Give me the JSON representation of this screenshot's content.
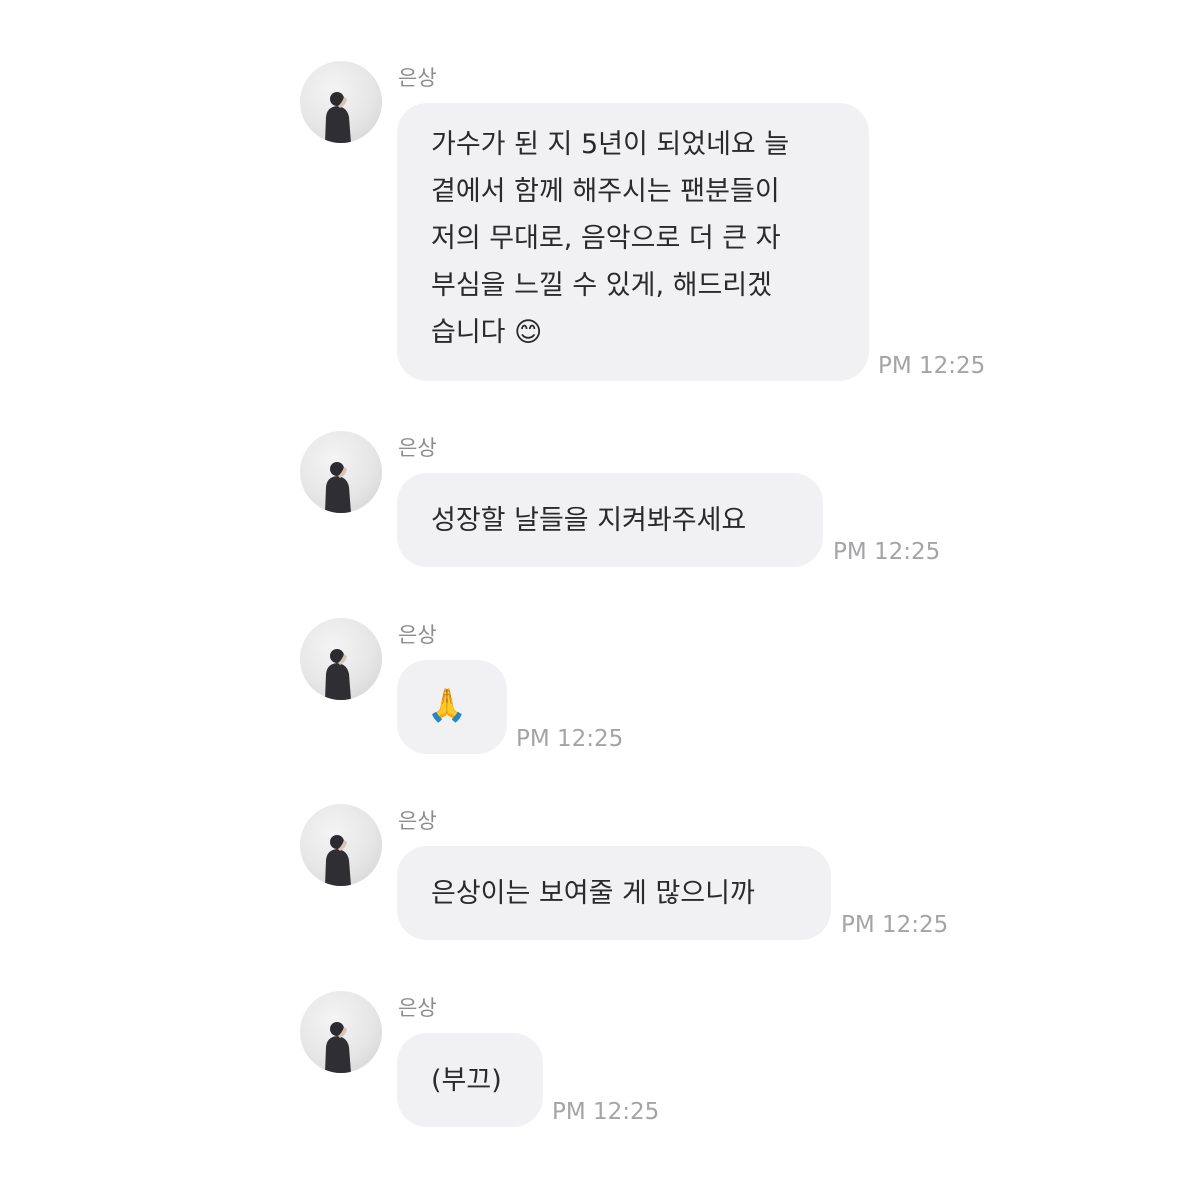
{
  "messages": [
    {
      "sender": "은상",
      "lines": [
        "가수가 된 지 5년이 되었네요 늘",
        "곁에서 함께 해주시는 팬분들이",
        "저의 무대로, 음악으로 더 큰 자",
        "부심을 느낄 수 있게, 해드리겠",
        "습니다 😊"
      ],
      "time": "PM 12:25"
    },
    {
      "sender": "은상",
      "lines": [
        "성장할 날들을 지켜봐주세요"
      ],
      "time": "PM 12:25"
    },
    {
      "sender": "은상",
      "lines": [
        "🙏"
      ],
      "time": "PM 12:25"
    },
    {
      "sender": "은상",
      "lines": [
        "은상이는 보여줄 게 많으니까"
      ],
      "time": "PM 12:25"
    },
    {
      "sender": "은상",
      "lines": [
        "(부끄)"
      ],
      "time": "PM 12:25"
    }
  ]
}
